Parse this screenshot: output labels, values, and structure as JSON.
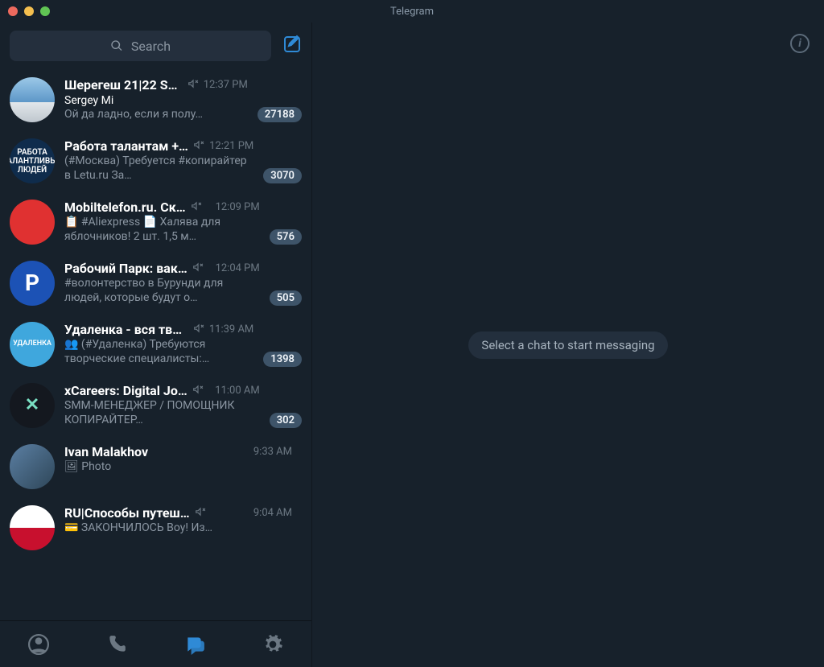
{
  "window": {
    "title": "Telegram"
  },
  "search": {
    "placeholder": "Search"
  },
  "main": {
    "placeholder": "Select a chat to start messaging",
    "info_tooltip": "i"
  },
  "bottom_tabs": {
    "contacts": "Contacts",
    "calls": "Calls",
    "chats": "Chats",
    "settings": "Settings"
  },
  "chats": [
    {
      "title": "Шерегеш 21|22 Sh…",
      "muted": true,
      "time": "12:37 PM",
      "sender": "Sergey Mi",
      "preview": "Ой да ладно, если я полу…",
      "unread": "27188",
      "avatar_class": "av-photo1",
      "avatar_text": ""
    },
    {
      "title": "Работа талантам +…",
      "muted": true,
      "time": "12:21 PM",
      "sender": "",
      "preview": "(#Москва) Требуется #копирайтер в Letu.ru   За…",
      "unread": "3070",
      "avatar_class": "av-blue",
      "avatar_text": "РАБОТА ТАЛАНТЛИВЫХ ЛЮДЕЙ"
    },
    {
      "title": "Mobiltelefon.ru. Ск…",
      "muted": true,
      "time": "12:09 PM",
      "sender": "",
      "preview": "📋 #Aliexpress   📄 Халява для яблочников! 2 шт. 1,5 м…",
      "unread": "576",
      "avatar_class": "av-red",
      "avatar_text": ""
    },
    {
      "title": "Рабочий Парк: вак…",
      "muted": true,
      "time": "12:04 PM",
      "sender": "",
      "preview": "#волонтерство в Бурунди для людей, которые будут о…",
      "unread": "505",
      "avatar_class": "av-pblue",
      "avatar_text": "Р"
    },
    {
      "title": "Удаленка - вся тво…",
      "muted": true,
      "time": "11:39 AM",
      "sender": "",
      "preview": "👥 (#Удаленка) Требуются творческие специалисты:…",
      "unread": "1398",
      "avatar_class": "av-cyan",
      "avatar_text": "УДАЛЕНКА"
    },
    {
      "title": "xCareers: Digital Jo…",
      "muted": true,
      "time": "11:00 AM",
      "sender": "",
      "preview": "SMM-МЕНЕДЖЕР / ПОМОЩНИК КОПИРАЙТЕР…",
      "unread": "302",
      "avatar_class": "av-dark",
      "avatar_text": "✕"
    },
    {
      "title": "Ivan Malakhov",
      "muted": false,
      "time": "9:33 AM",
      "sender": "",
      "preview": "🖼 Photo",
      "unread": "",
      "avatar_class": "av-person",
      "avatar_text": ""
    },
    {
      "title": "RU|Способы путеш…",
      "muted": true,
      "time": "9:04 AM",
      "sender": "",
      "preview": "💳 ЗАКОНЧИЛОСЬ  Boy! Из…",
      "unread": "",
      "avatar_class": "av-flag",
      "avatar_text": ""
    }
  ]
}
